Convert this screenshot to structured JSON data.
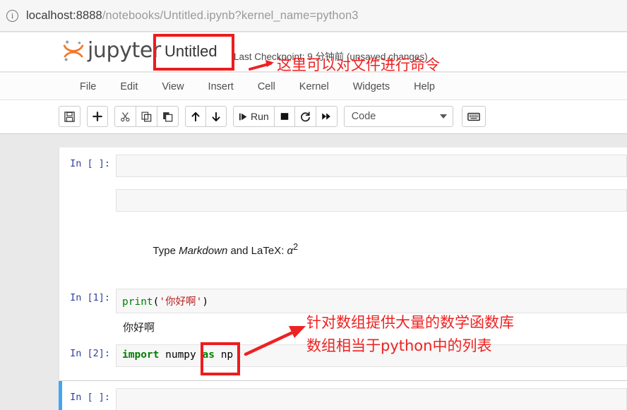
{
  "browser": {
    "info_icon": "info-icon",
    "url_host": "localhost:8888",
    "url_path": "/notebooks/Untitled.ipynb?kernel_name=python3"
  },
  "header": {
    "logo_text": "jupyter",
    "notebook_title": "Untitled",
    "checkpoint": "Last Checkpoint: 9 分钟前   (unsaved changes)"
  },
  "menubar": {
    "items": [
      {
        "label": "File"
      },
      {
        "label": "Edit"
      },
      {
        "label": "View"
      },
      {
        "label": "Insert"
      },
      {
        "label": "Cell"
      },
      {
        "label": "Kernel"
      },
      {
        "label": "Widgets"
      },
      {
        "label": "Help"
      }
    ]
  },
  "toolbar": {
    "save_icon": "save-icon",
    "add_icon": "plus-icon",
    "cut_icon": "scissors-icon",
    "copy_icon": "copy-icon",
    "paste_icon": "paste-icon",
    "move_up_icon": "arrow-up-icon",
    "move_down_icon": "arrow-down-icon",
    "run_icon": "run-icon",
    "run_label": "Run",
    "stop_icon": "stop-icon",
    "restart_icon": "restart-icon",
    "restart_run_all_icon": "fast-forward-icon",
    "cell_type_value": "Code",
    "cell_type_caret": "chevron-down-icon",
    "command_palette_icon": "keyboard-icon"
  },
  "notebook": {
    "cells": [
      {
        "prompt": "In [ ]:",
        "type": "code",
        "source": "",
        "output": null
      },
      {
        "prompt": "",
        "type": "code",
        "source": "",
        "output": null
      },
      {
        "prompt": "",
        "type": "markdown",
        "source": "Type Markdown and LaTeX: α²",
        "output": null
      },
      {
        "prompt": "In [1]:",
        "type": "code",
        "source": "print('你好啊')",
        "output": "你好啊"
      },
      {
        "prompt": "In [2]:",
        "type": "code",
        "source": "import numpy as np",
        "output": null
      },
      {
        "prompt": "In [ ]:",
        "type": "code",
        "source": "",
        "output": null,
        "selected": true
      }
    ]
  },
  "annotations": {
    "title_box": "red-highlight-box-title",
    "numpy_box": "red-highlight-box-numpy",
    "arrow_title": "red-arrow-icon",
    "arrow_numpy": "red-arrow-icon",
    "note_title": "这里可以对文件进行命令",
    "note_numpy_line1": "针对数组提供大量的数学函数库",
    "note_numpy_line2": "数组相当于python中的列表"
  },
  "colors": {
    "annotation_red": "#ee2222",
    "jupyter_orange": "#f37726",
    "selected_cell_blue": "#42A5F5",
    "prompt_blue": "#303F9F"
  }
}
